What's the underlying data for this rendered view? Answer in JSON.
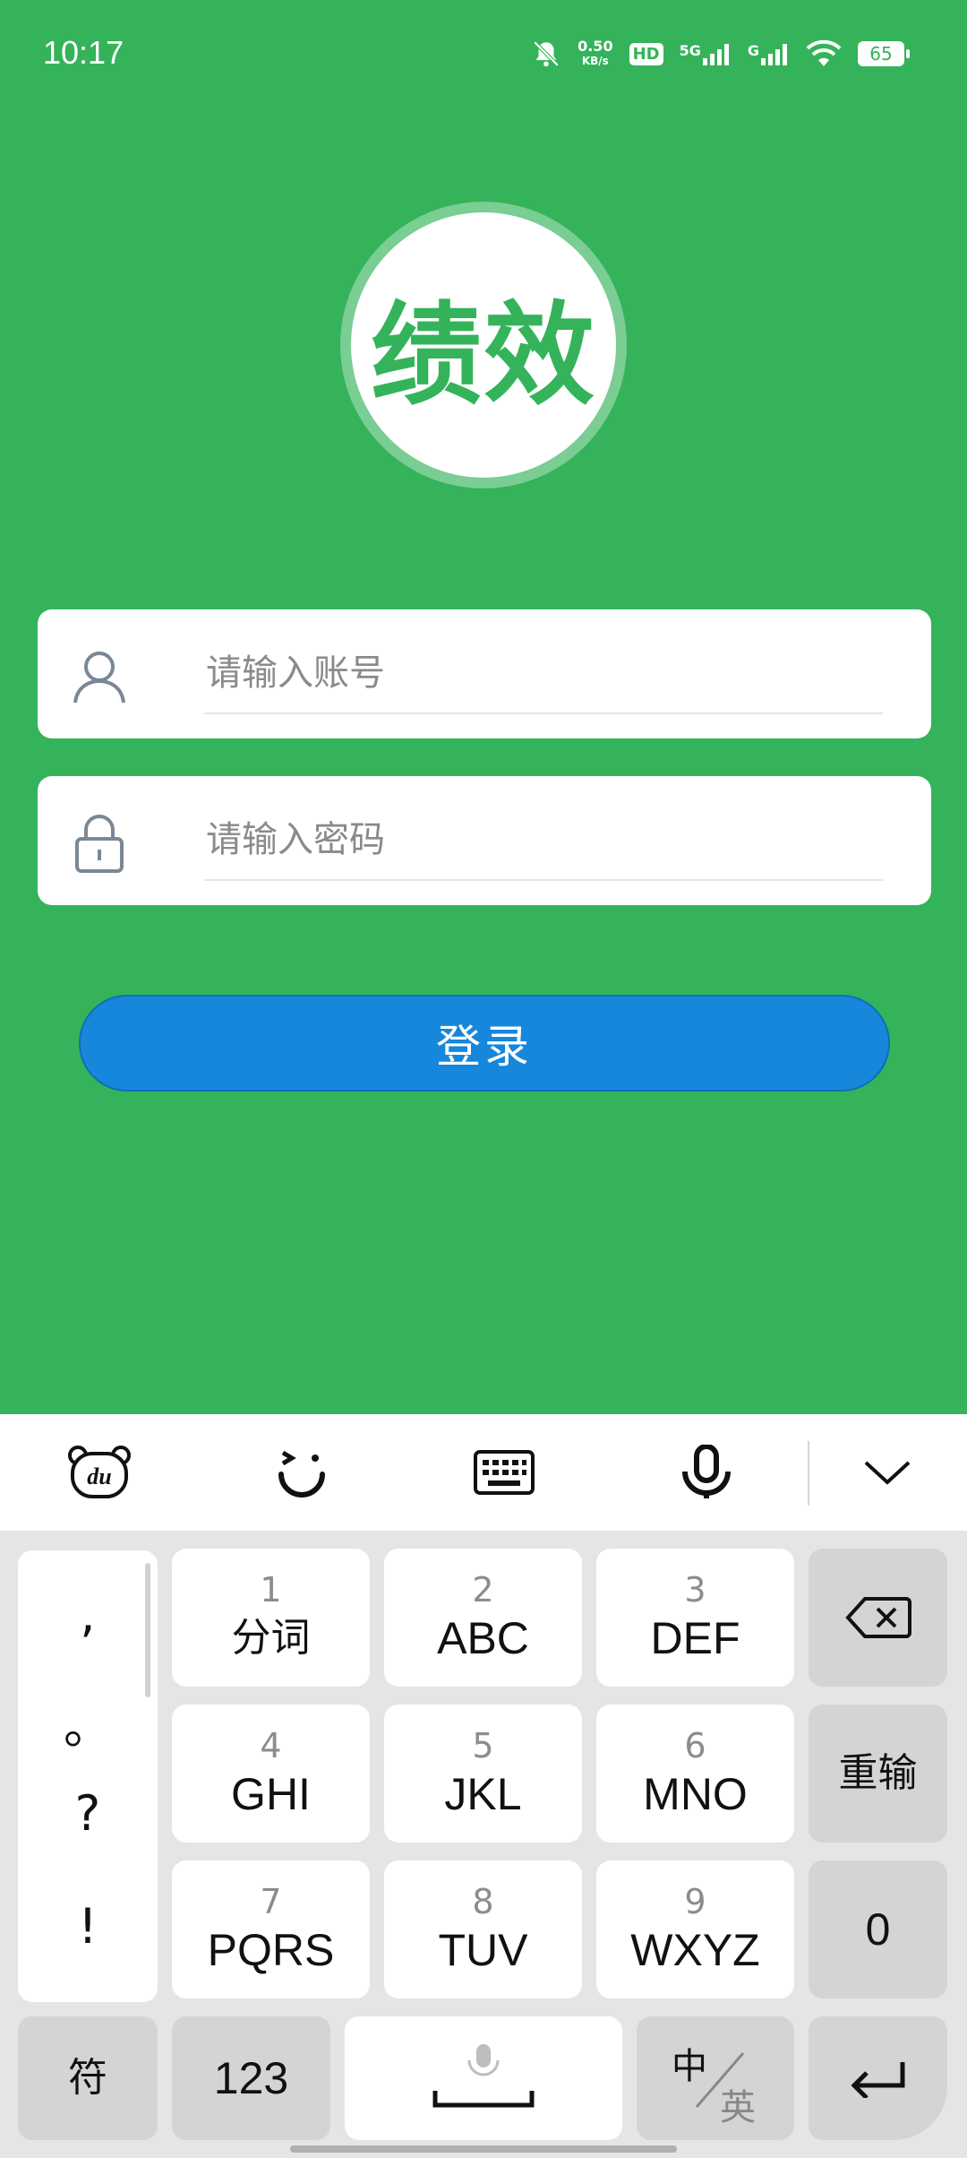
{
  "status_bar": {
    "time": "10:17",
    "net_speed_value": "0.50",
    "net_speed_unit": "KB/s",
    "hd_label": "HD",
    "net_5g": "5G",
    "net_g": "G",
    "battery": "65"
  },
  "logo": {
    "text": "绩效"
  },
  "form": {
    "account_placeholder": "请输入账号",
    "password_placeholder": "请输入密码",
    "login_label": "登录"
  },
  "keyboard": {
    "toolbar": {
      "du_label": "du"
    },
    "punctuation": [
      ",",
      "。",
      "?",
      "!"
    ],
    "keys": [
      {
        "num": "1",
        "label": "分词"
      },
      {
        "num": "2",
        "label": "ABC"
      },
      {
        "num": "3",
        "label": "DEF"
      },
      {
        "num": "4",
        "label": "GHI"
      },
      {
        "num": "5",
        "label": "JKL"
      },
      {
        "num": "6",
        "label": "MNO"
      },
      {
        "num": "7",
        "label": "PQRS"
      },
      {
        "num": "8",
        "label": "TUV"
      },
      {
        "num": "9",
        "label": "WXYZ"
      }
    ],
    "reinput_label": "重输",
    "zero_label": "0",
    "symbol_label": "符",
    "numeric_label": "123",
    "lang_cn": "中",
    "lang_en": "英"
  },
  "colors": {
    "background": "#34B35A",
    "login_button": "#1687DB",
    "keyboard_bg": "#E5E5E5"
  }
}
